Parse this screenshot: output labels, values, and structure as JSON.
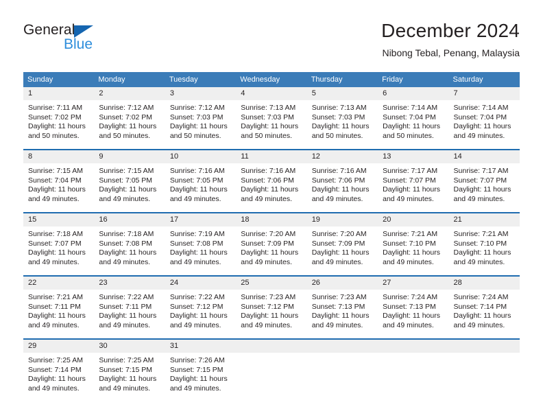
{
  "brand": {
    "name_part1": "General",
    "name_part2": "Blue",
    "accent_color": "#2d8ddb",
    "triangle_color": "#1565b0"
  },
  "header": {
    "title": "December 2024",
    "subtitle": "Nibong Tebal, Penang, Malaysia"
  },
  "theme": {
    "header_row_bg": "#3b7cb8",
    "row_separator": "#1f6cb0",
    "daynum_bg": "#efefef",
    "text": "#231f20"
  },
  "weekday_headers": [
    "Sunday",
    "Monday",
    "Tuesday",
    "Wednesday",
    "Thursday",
    "Friday",
    "Saturday"
  ],
  "weeks": [
    [
      {
        "day": "1",
        "sunrise": "Sunrise: 7:11 AM",
        "sunset": "Sunset: 7:02 PM",
        "daylight1": "Daylight: 11 hours",
        "daylight2": "and 50 minutes."
      },
      {
        "day": "2",
        "sunrise": "Sunrise: 7:12 AM",
        "sunset": "Sunset: 7:02 PM",
        "daylight1": "Daylight: 11 hours",
        "daylight2": "and 50 minutes."
      },
      {
        "day": "3",
        "sunrise": "Sunrise: 7:12 AM",
        "sunset": "Sunset: 7:03 PM",
        "daylight1": "Daylight: 11 hours",
        "daylight2": "and 50 minutes."
      },
      {
        "day": "4",
        "sunrise": "Sunrise: 7:13 AM",
        "sunset": "Sunset: 7:03 PM",
        "daylight1": "Daylight: 11 hours",
        "daylight2": "and 50 minutes."
      },
      {
        "day": "5",
        "sunrise": "Sunrise: 7:13 AM",
        "sunset": "Sunset: 7:03 PM",
        "daylight1": "Daylight: 11 hours",
        "daylight2": "and 50 minutes."
      },
      {
        "day": "6",
        "sunrise": "Sunrise: 7:14 AM",
        "sunset": "Sunset: 7:04 PM",
        "daylight1": "Daylight: 11 hours",
        "daylight2": "and 50 minutes."
      },
      {
        "day": "7",
        "sunrise": "Sunrise: 7:14 AM",
        "sunset": "Sunset: 7:04 PM",
        "daylight1": "Daylight: 11 hours",
        "daylight2": "and 49 minutes."
      }
    ],
    [
      {
        "day": "8",
        "sunrise": "Sunrise: 7:15 AM",
        "sunset": "Sunset: 7:04 PM",
        "daylight1": "Daylight: 11 hours",
        "daylight2": "and 49 minutes."
      },
      {
        "day": "9",
        "sunrise": "Sunrise: 7:15 AM",
        "sunset": "Sunset: 7:05 PM",
        "daylight1": "Daylight: 11 hours",
        "daylight2": "and 49 minutes."
      },
      {
        "day": "10",
        "sunrise": "Sunrise: 7:16 AM",
        "sunset": "Sunset: 7:05 PM",
        "daylight1": "Daylight: 11 hours",
        "daylight2": "and 49 minutes."
      },
      {
        "day": "11",
        "sunrise": "Sunrise: 7:16 AM",
        "sunset": "Sunset: 7:06 PM",
        "daylight1": "Daylight: 11 hours",
        "daylight2": "and 49 minutes."
      },
      {
        "day": "12",
        "sunrise": "Sunrise: 7:16 AM",
        "sunset": "Sunset: 7:06 PM",
        "daylight1": "Daylight: 11 hours",
        "daylight2": "and 49 minutes."
      },
      {
        "day": "13",
        "sunrise": "Sunrise: 7:17 AM",
        "sunset": "Sunset: 7:07 PM",
        "daylight1": "Daylight: 11 hours",
        "daylight2": "and 49 minutes."
      },
      {
        "day": "14",
        "sunrise": "Sunrise: 7:17 AM",
        "sunset": "Sunset: 7:07 PM",
        "daylight1": "Daylight: 11 hours",
        "daylight2": "and 49 minutes."
      }
    ],
    [
      {
        "day": "15",
        "sunrise": "Sunrise: 7:18 AM",
        "sunset": "Sunset: 7:07 PM",
        "daylight1": "Daylight: 11 hours",
        "daylight2": "and 49 minutes."
      },
      {
        "day": "16",
        "sunrise": "Sunrise: 7:18 AM",
        "sunset": "Sunset: 7:08 PM",
        "daylight1": "Daylight: 11 hours",
        "daylight2": "and 49 minutes."
      },
      {
        "day": "17",
        "sunrise": "Sunrise: 7:19 AM",
        "sunset": "Sunset: 7:08 PM",
        "daylight1": "Daylight: 11 hours",
        "daylight2": "and 49 minutes."
      },
      {
        "day": "18",
        "sunrise": "Sunrise: 7:20 AM",
        "sunset": "Sunset: 7:09 PM",
        "daylight1": "Daylight: 11 hours",
        "daylight2": "and 49 minutes."
      },
      {
        "day": "19",
        "sunrise": "Sunrise: 7:20 AM",
        "sunset": "Sunset: 7:09 PM",
        "daylight1": "Daylight: 11 hours",
        "daylight2": "and 49 minutes."
      },
      {
        "day": "20",
        "sunrise": "Sunrise: 7:21 AM",
        "sunset": "Sunset: 7:10 PM",
        "daylight1": "Daylight: 11 hours",
        "daylight2": "and 49 minutes."
      },
      {
        "day": "21",
        "sunrise": "Sunrise: 7:21 AM",
        "sunset": "Sunset: 7:10 PM",
        "daylight1": "Daylight: 11 hours",
        "daylight2": "and 49 minutes."
      }
    ],
    [
      {
        "day": "22",
        "sunrise": "Sunrise: 7:21 AM",
        "sunset": "Sunset: 7:11 PM",
        "daylight1": "Daylight: 11 hours",
        "daylight2": "and 49 minutes."
      },
      {
        "day": "23",
        "sunrise": "Sunrise: 7:22 AM",
        "sunset": "Sunset: 7:11 PM",
        "daylight1": "Daylight: 11 hours",
        "daylight2": "and 49 minutes."
      },
      {
        "day": "24",
        "sunrise": "Sunrise: 7:22 AM",
        "sunset": "Sunset: 7:12 PM",
        "daylight1": "Daylight: 11 hours",
        "daylight2": "and 49 minutes."
      },
      {
        "day": "25",
        "sunrise": "Sunrise: 7:23 AM",
        "sunset": "Sunset: 7:12 PM",
        "daylight1": "Daylight: 11 hours",
        "daylight2": "and 49 minutes."
      },
      {
        "day": "26",
        "sunrise": "Sunrise: 7:23 AM",
        "sunset": "Sunset: 7:13 PM",
        "daylight1": "Daylight: 11 hours",
        "daylight2": "and 49 minutes."
      },
      {
        "day": "27",
        "sunrise": "Sunrise: 7:24 AM",
        "sunset": "Sunset: 7:13 PM",
        "daylight1": "Daylight: 11 hours",
        "daylight2": "and 49 minutes."
      },
      {
        "day": "28",
        "sunrise": "Sunrise: 7:24 AM",
        "sunset": "Sunset: 7:14 PM",
        "daylight1": "Daylight: 11 hours",
        "daylight2": "and 49 minutes."
      }
    ],
    [
      {
        "day": "29",
        "sunrise": "Sunrise: 7:25 AM",
        "sunset": "Sunset: 7:14 PM",
        "daylight1": "Daylight: 11 hours",
        "daylight2": "and 49 minutes."
      },
      {
        "day": "30",
        "sunrise": "Sunrise: 7:25 AM",
        "sunset": "Sunset: 7:15 PM",
        "daylight1": "Daylight: 11 hours",
        "daylight2": "and 49 minutes."
      },
      {
        "day": "31",
        "sunrise": "Sunrise: 7:26 AM",
        "sunset": "Sunset: 7:15 PM",
        "daylight1": "Daylight: 11 hours",
        "daylight2": "and 49 minutes."
      },
      {
        "day": "",
        "sunrise": "",
        "sunset": "",
        "daylight1": "",
        "daylight2": ""
      },
      {
        "day": "",
        "sunrise": "",
        "sunset": "",
        "daylight1": "",
        "daylight2": ""
      },
      {
        "day": "",
        "sunrise": "",
        "sunset": "",
        "daylight1": "",
        "daylight2": ""
      },
      {
        "day": "",
        "sunrise": "",
        "sunset": "",
        "daylight1": "",
        "daylight2": ""
      }
    ]
  ]
}
